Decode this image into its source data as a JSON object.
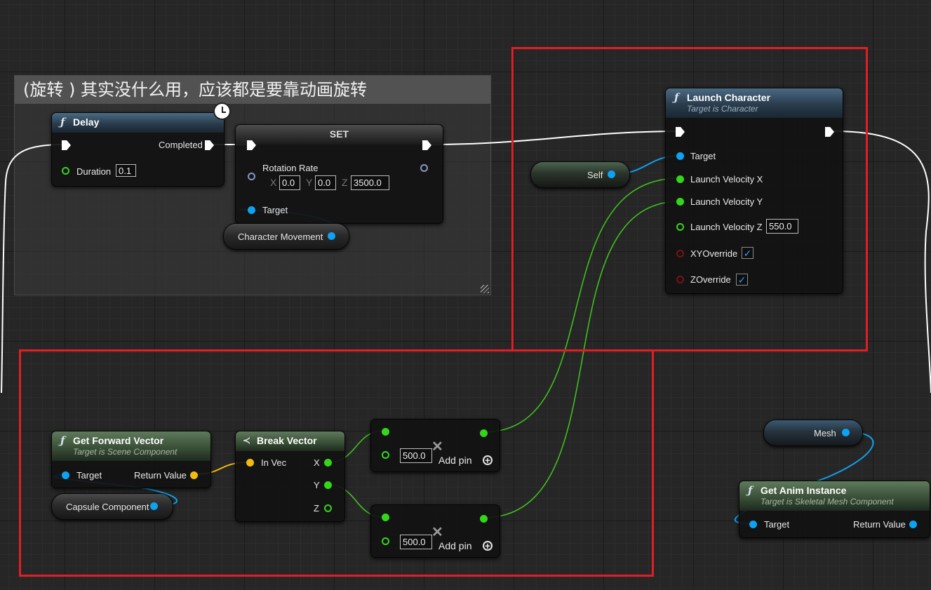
{
  "comment": {
    "title": "(旋转 ) 其实没什么用，应该都是要靠动画旋转"
  },
  "nodes": {
    "delay": {
      "title": "Delay",
      "completed_label": "Completed",
      "duration_label": "Duration",
      "duration_value": "0.1"
    },
    "set": {
      "title": "SET",
      "rotation_rate_label": "Rotation Rate",
      "axis_x": "X",
      "x_value": "0.0",
      "axis_y": "Y",
      "y_value": "0.0",
      "axis_z": "Z",
      "z_value": "3500.0",
      "target_label": "Target"
    },
    "character_movement": {
      "label": "Character Movement"
    },
    "self": {
      "label": "Self"
    },
    "launch_character": {
      "title": "Launch Character",
      "subtitle": "Target is Character",
      "target_label": "Target",
      "velocity_x_label": "Launch Velocity X",
      "velocity_y_label": "Launch Velocity Y",
      "velocity_z_label": "Launch Velocity Z",
      "velocity_z_value": "550.0",
      "xy_override_label": "XYOverride",
      "xy_override_checked": true,
      "z_override_label": "ZOverride",
      "z_override_checked": true
    },
    "get_forward_vector": {
      "title": "Get Forward Vector",
      "subtitle": "Target is Scene Component",
      "target_label": "Target",
      "return_label": "Return Value"
    },
    "capsule_component": {
      "label": "Capsule Component"
    },
    "break_vector": {
      "title": "Break Vector",
      "in_vec_label": "In Vec",
      "x_label": "X",
      "y_label": "Y",
      "z_label": "Z"
    },
    "multiply_1": {
      "value": "500.0",
      "add_pin_label": "Add pin"
    },
    "multiply_2": {
      "value": "500.0",
      "add_pin_label": "Add pin"
    },
    "mesh": {
      "label": "Mesh"
    },
    "get_anim_instance": {
      "title": "Get Anim Instance",
      "subtitle": "Target is Skeletal Mesh Component",
      "target_label": "Target",
      "return_label": "Return Value"
    }
  },
  "icons": {
    "function": "ƒ",
    "check": "✓",
    "remove": "✕",
    "plus": "+",
    "break_vector": "≺"
  },
  "colors": {
    "exec_wire": "#ffffff",
    "float_wire": "#3fc91c",
    "object_wire": "#0ea2f0",
    "vector_wire": "#f6b90e",
    "highlight_box": "#e01e26",
    "function_header": "#3d5a72",
    "pure_header": "#4e6a4c"
  }
}
